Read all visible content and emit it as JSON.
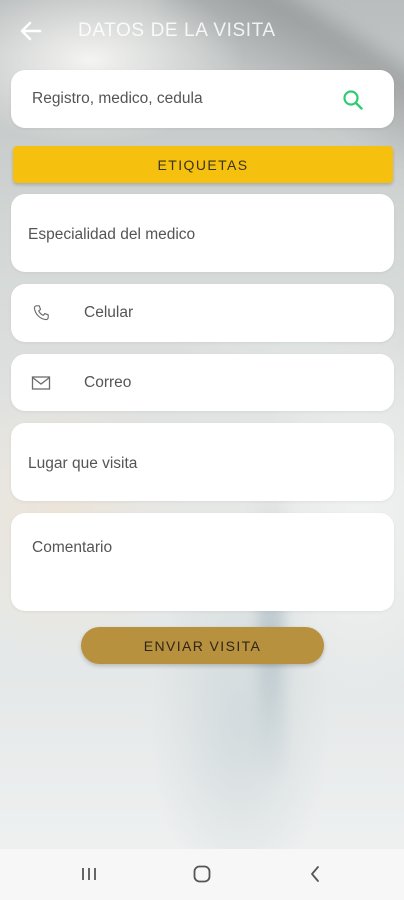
{
  "header": {
    "title": "DATOS DE LA VISITA",
    "back_icon": "arrow-left-icon"
  },
  "search": {
    "placeholder": "Registro, medico, cedula",
    "icon": "search-icon",
    "icon_color": "#2ecc71"
  },
  "etiquetas": {
    "label": "ETIQUETAS",
    "color": "#f6c10e"
  },
  "fields": {
    "especialidad": "Especialidad del medico",
    "celular": "Celular",
    "correo": "Correo",
    "lugar": "Lugar que visita",
    "comentario": "Comentario"
  },
  "submit": {
    "label": "ENVIAR VISITA",
    "color": "#b8913e"
  },
  "navbar": {
    "icons": [
      "recents-icon",
      "home-icon",
      "back-icon"
    ]
  }
}
